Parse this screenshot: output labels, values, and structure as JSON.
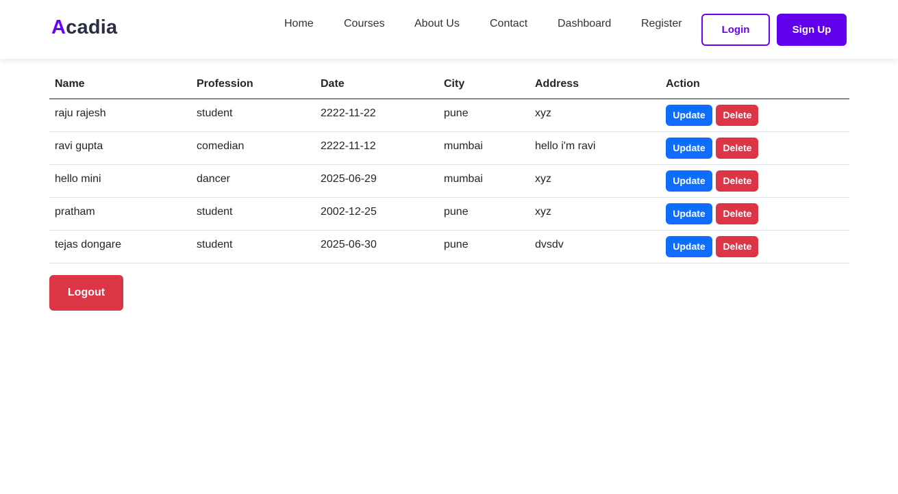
{
  "brand": {
    "first_letter": "A",
    "rest": "cadia",
    "accent_color": "#6a00f4"
  },
  "nav": {
    "links": [
      "Home",
      "Courses",
      "About Us",
      "Contact",
      "Dashboard",
      "Register"
    ],
    "login_label": "Login",
    "signup_label": "Sign Up"
  },
  "table": {
    "headers": [
      "Name",
      "Profession",
      "Date",
      "City",
      "Address",
      "Action"
    ],
    "update_label": "Update",
    "delete_label": "Delete",
    "rows": [
      {
        "name": "raju rajesh",
        "profession": "student",
        "date": "2222-11-22",
        "city": "pune",
        "address": "xyz"
      },
      {
        "name": "ravi gupta",
        "profession": "comedian",
        "date": "2222-11-12",
        "city": "mumbai",
        "address": "hello i'm ravi"
      },
      {
        "name": "hello mini",
        "profession": "dancer",
        "date": "2025-06-29",
        "city": "mumbai",
        "address": "xyz"
      },
      {
        "name": "pratham",
        "profession": "student",
        "date": "2002-12-25",
        "city": "pune",
        "address": "xyz"
      },
      {
        "name": "tejas dongare",
        "profession": "student",
        "date": "2025-06-30",
        "city": "pune",
        "address": "dvsdv"
      }
    ]
  },
  "logout_label": "Logout",
  "colors": {
    "primary_purple": "#6200ee",
    "update_blue": "#0d6efd",
    "delete_red": "#dc3545"
  }
}
